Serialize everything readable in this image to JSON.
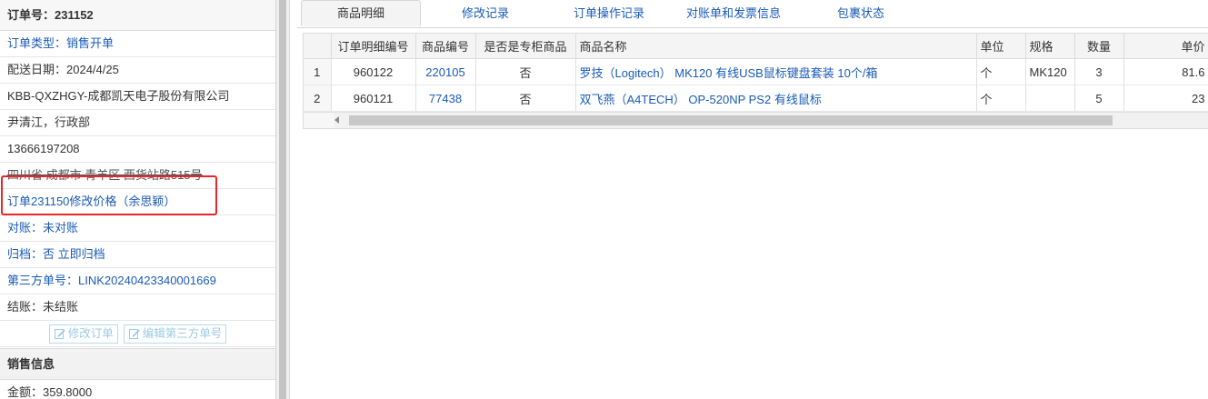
{
  "order": {
    "title": "订单号：231152",
    "rows": [
      {
        "label": "订单类型：销售开单",
        "style": "blue"
      },
      {
        "label": "配送日期：2024/4/25",
        "style": "plain"
      },
      {
        "label": "KBB-QXZHGY-成都凯天电子股份有限公司",
        "style": "plain"
      },
      {
        "label": "尹清江，行政部",
        "style": "plain"
      },
      {
        "label": "13666197208",
        "style": "plain"
      },
      {
        "label": "四川省 成都市 青羊区 西货站路515号",
        "style": "strike"
      },
      {
        "label": "订单231150修改价格（余思颖）",
        "style": "link"
      },
      {
        "label": "对账：未对账",
        "style": "blue"
      },
      {
        "label_prefix": "归档：否 ",
        "label_link": "立即归档",
        "style": "mixed"
      },
      {
        "label": "第三方单号：LINK20240423340001669",
        "style": "blue"
      },
      {
        "label": "结账：未结账",
        "style": "plain"
      }
    ],
    "buttons": {
      "edit_order": "修改订单",
      "edit_third_party": "编辑第三方单号"
    },
    "sales_section": "销售信息",
    "amount": "金额：359.8000"
  },
  "tabs": [
    "商品明细",
    "修改记录",
    "订单操作记录",
    "对账单和发票信息",
    "包裹状态"
  ],
  "active_tab": 0,
  "table": {
    "headers": [
      "",
      "订单明细编号",
      "商品编号",
      "是否是专柜商品",
      "商品名称",
      "单位",
      "规格",
      "数量",
      "单价"
    ],
    "rows": [
      {
        "n": "1",
        "detail_id": "960122",
        "sku": "220105",
        "counter": "否",
        "name": "罗技（Logitech） MK120 有线USB鼠标键盘套装 10个/箱",
        "unit": "个",
        "spec": "MK120",
        "qty": "3",
        "price": "81.6"
      },
      {
        "n": "2",
        "detail_id": "960121",
        "sku": "77438",
        "counter": "否",
        "name": "双飞燕（A4TECH） OP-520NP PS2 有线鼠标",
        "unit": "个",
        "spec": "",
        "qty": "5",
        "price": "23"
      }
    ]
  },
  "colors": {
    "link": "#1a5bb8",
    "highlight_border": "#e8262a"
  }
}
